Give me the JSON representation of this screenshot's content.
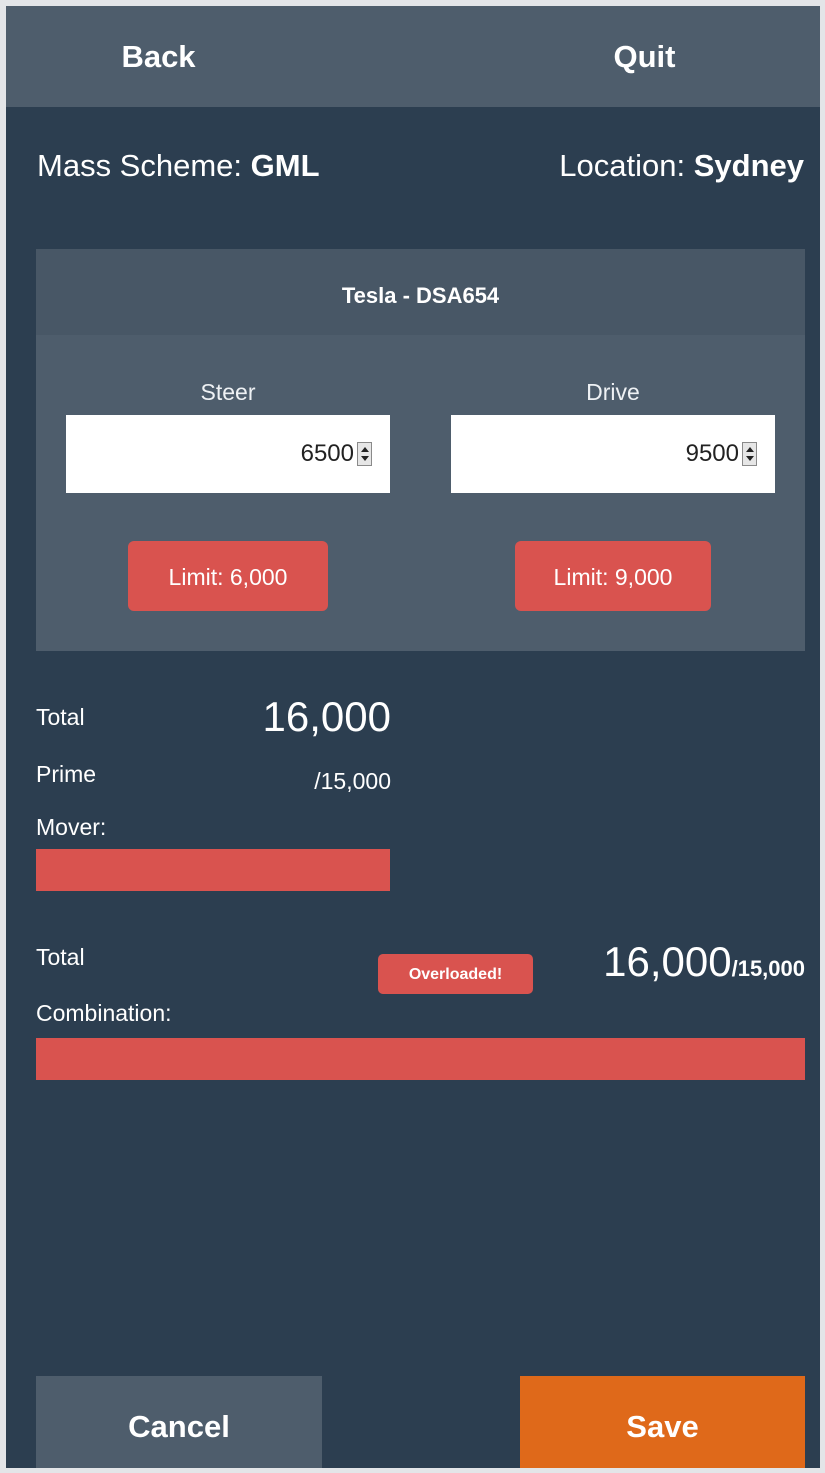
{
  "nav": {
    "back_label": "Back",
    "quit_label": "Quit"
  },
  "info": {
    "scheme_label": "Mass Scheme:",
    "scheme_value": "GML",
    "location_label": "Location:",
    "location_value": "Sydney"
  },
  "vehicle": {
    "title": "Tesla - DSA654",
    "steer": {
      "label": "Steer",
      "value": "6500",
      "limit": "Limit: 6,000"
    },
    "drive": {
      "label": "Drive",
      "value": "9500",
      "limit": "Limit: 9,000"
    }
  },
  "prime_mover": {
    "label_line1": "Total",
    "label_line2": "Prime",
    "label_line3": "Mover:",
    "value": "16,000",
    "limit": "/15,000",
    "fill_fraction": 1.0
  },
  "combination": {
    "label_line1": "Total",
    "label_line2": "Combination:",
    "badge": "Overloaded!",
    "value": "16,000",
    "limit": "/15,000",
    "fill_fraction": 1.0
  },
  "footer": {
    "cancel_label": "Cancel",
    "save_label": "Save"
  },
  "colors": {
    "background": "#2c3e50",
    "panel": "#4e5d6c",
    "danger": "#d9534f",
    "save_accent": "#df691a"
  },
  "icons": {
    "spinner": "spinner-arrows-icon"
  }
}
